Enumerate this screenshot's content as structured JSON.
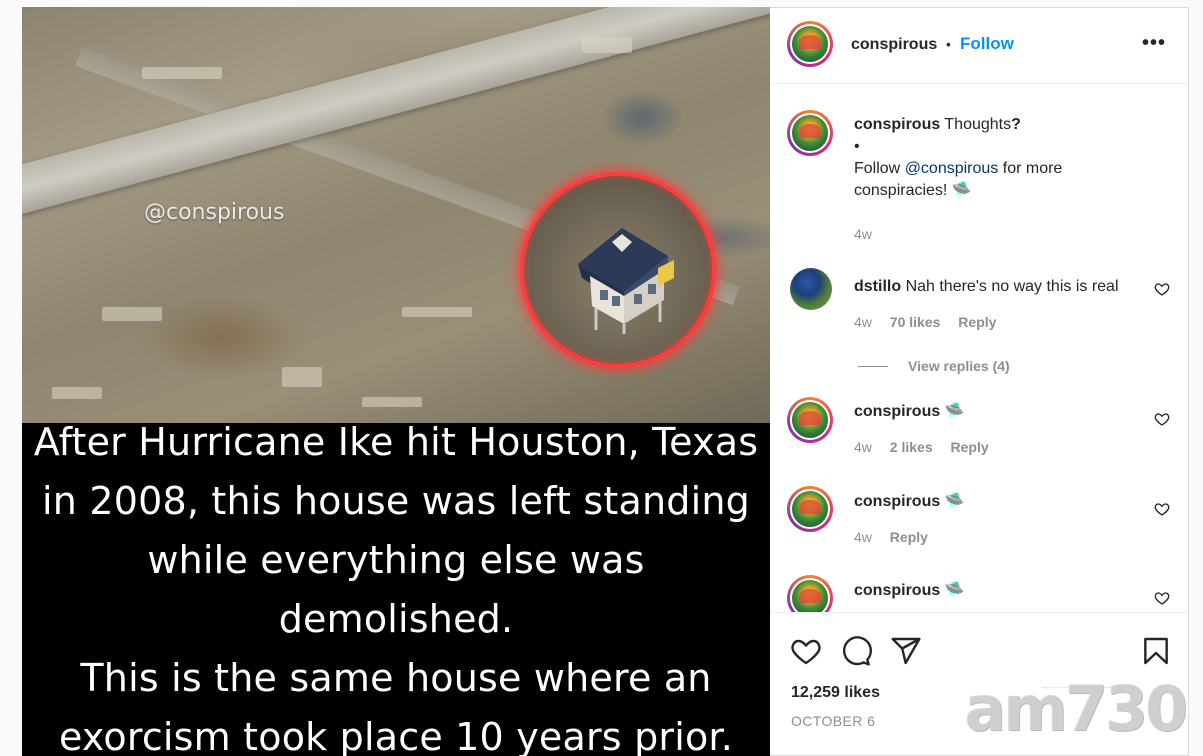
{
  "post": {
    "image_watermark": "@conspirous",
    "caption_lines": [
      "After Hurricane Ike hit Houston, Texas",
      "in 2008, this house was left standing",
      "while everything else was demolished.",
      "This is the same house where an",
      "exorcism took place 10 years prior."
    ]
  },
  "header": {
    "username": "conspirous",
    "separator": "•",
    "follow_label": "Follow",
    "more_label": "•••"
  },
  "caption_comment": {
    "username": "conspirous",
    "text": "Thoughts",
    "question": "?",
    "bullet": "•",
    "follow_prefix": "Follow ",
    "mention": "@conspirous",
    "follow_suffix": " for more conspiracies! 🛸",
    "time": "4w"
  },
  "comments": [
    {
      "username": "dstillo",
      "text": "Nah there's no way this is real",
      "time": "4w",
      "likes": "70 likes",
      "reply_label": "Reply",
      "view_replies": "View replies (4)"
    },
    {
      "username": "conspirous",
      "text": "🛸",
      "time": "4w",
      "likes": "2 likes",
      "reply_label": "Reply"
    },
    {
      "username": "conspirous",
      "text": "🛸",
      "time": "4w",
      "reply_label": "Reply"
    },
    {
      "username": "conspirous",
      "text": "🛸"
    }
  ],
  "actions": {
    "like_icon": "heart-icon",
    "comment_icon": "comment-icon",
    "share_icon": "paper-plane-icon",
    "save_icon": "bookmark-icon"
  },
  "stats": {
    "likes": "12,259 likes",
    "date": "OCTOBER 6"
  },
  "overlay_logo": {
    "text": "am730",
    "subtext": "— — — — — — —"
  },
  "colors": {
    "follow": "#0095f6",
    "mention": "#00376b",
    "highlight_circle": "#ff3b3b"
  }
}
